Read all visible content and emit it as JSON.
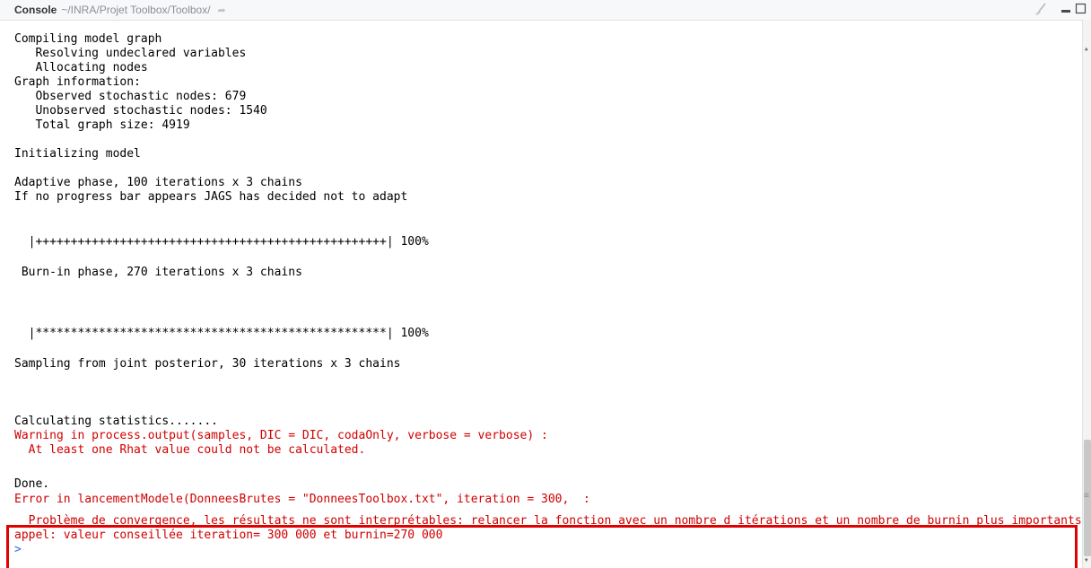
{
  "titlebar": {
    "title": "Console",
    "path": "~/INRA/Projet Toolbox/Toolbox/",
    "goto_icon": "arrow-right-icon",
    "broom_icon": "broom-icon",
    "minimize_icon": "minimize-icon",
    "maximize_icon": "maximize-icon"
  },
  "colors": {
    "error_text": "#d00000",
    "highlight_box": "#e00000",
    "prompt": "#3b6de0"
  },
  "console": {
    "lines": [
      "Compiling model graph",
      "   Resolving undeclared variables",
      "   Allocating nodes",
      "Graph information:",
      "   Observed stochastic nodes: 679",
      "   Unobserved stochastic nodes: 1540",
      "   Total graph size: 4919",
      "",
      "Initializing model",
      "",
      "Adaptive phase, 100 iterations x 3 chains",
      "If no progress bar appears JAGS has decided not to adapt",
      "",
      "  |++++++++++++++++++++++++++++++++++++++++++++++++++| 100%",
      "",
      " Burn-in phase, 270 iterations x 3 chains",
      "",
      "  |**************************************************| 100%",
      "",
      "Sampling from joint posterior, 30 iterations x 3 chains",
      "",
      "",
      "Calculating statistics.......",
      "Warning in process.output(samples, DIC = DIC, codaOnly, verbose = verbose) :",
      "  At least one Rhat value could not be calculated.",
      "",
      "Done.",
      "Error in lancementModele(DonneesBrutes = \"DonneesToolbox.txt\", iteration = 300,  :",
      "  Problème de convergence, les résultats ne sont interprétables: relancer la fonction avec un nombre d itérations et un nombre de burnin plus importants. R",
      "appel: valeur conseillée iteration= 300 000 et burnin=270 000",
      ">"
    ],
    "error_line_indices": [
      23,
      24,
      27,
      28,
      29
    ],
    "prompt_line_index": 30
  }
}
